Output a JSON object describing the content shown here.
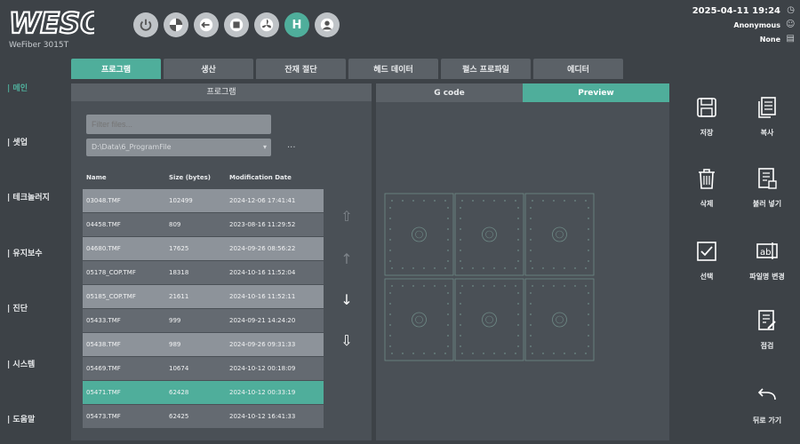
{
  "app": {
    "logo_text": "WESO",
    "model": "WeFiber 3015T"
  },
  "status": {
    "datetime": "2025-04-11 19:24",
    "user": "Anonymous",
    "file": "None"
  },
  "topbar": {
    "icons": [
      "power-icon",
      "pie-icon",
      "back-arrow-icon",
      "stop-icon",
      "fan-icon",
      "head-icon",
      "user-icon"
    ],
    "head_label": "H"
  },
  "leftnav": {
    "items": [
      {
        "label": "| 메인",
        "active": true
      },
      {
        "label": "| 셋업",
        "active": false
      },
      {
        "label": "| 테크놀러지",
        "active": false
      },
      {
        "label": "| 유지보수",
        "active": false
      },
      {
        "label": "| 진단",
        "active": false
      },
      {
        "label": "| 시스템",
        "active": false
      },
      {
        "label": "| 도움말",
        "active": false
      }
    ]
  },
  "tabs": [
    "프로그램",
    "생산",
    "잔재 절단",
    "헤드 데이터",
    "펄스 프로파일",
    "에디터"
  ],
  "program_panel": {
    "header": "프로그램",
    "filter_placeholder": "Filter files...",
    "path": "D:\\Data\\6_ProgramFile",
    "ellipsis": "...",
    "columns": [
      "Name",
      "Size (bytes)",
      "Modification Date"
    ],
    "rows": [
      {
        "name": "03048.TMF",
        "size": "102499",
        "date": "2024-12-06 17:41:41",
        "style": "light"
      },
      {
        "name": "04458.TMF",
        "size": "809",
        "date": "2023-08-16 11:29:52",
        "style": "dark"
      },
      {
        "name": "04680.TMF",
        "size": "17625",
        "date": "2024-09-26 08:56:22",
        "style": "light"
      },
      {
        "name": "05178_COP.TMF",
        "size": "18318",
        "date": "2024-10-16 11:52:04",
        "style": "dark"
      },
      {
        "name": "05185_COP.TMF",
        "size": "21611",
        "date": "2024-10-16 11:52:11",
        "style": "light"
      },
      {
        "name": "05433.TMF",
        "size": "999",
        "date": "2024-09-21 14:24:20",
        "style": "dark"
      },
      {
        "name": "05438.TMF",
        "size": "989",
        "date": "2024-09-26 09:31:33",
        "style": "light"
      },
      {
        "name": "05469.TMF",
        "size": "10674",
        "date": "2024-10-12 00:18:09",
        "style": "dark"
      },
      {
        "name": "05471.TMF",
        "size": "62428",
        "date": "2024-10-12 00:33:19",
        "style": "sel"
      },
      {
        "name": "05473.TMF",
        "size": "62425",
        "date": "2024-10-12 16:41:33",
        "style": "dark"
      }
    ],
    "scroll": {
      "top": "⇧",
      "up": "↑",
      "down": "↓",
      "bottom": "⇩"
    }
  },
  "preview_panel": {
    "tabs": [
      {
        "label": "G code",
        "active": false
      },
      {
        "label": "Preview",
        "active": true
      }
    ]
  },
  "actions": [
    {
      "label": "저장",
      "icon": "save-icon"
    },
    {
      "label": "복사",
      "icon": "copy-icon"
    },
    {
      "label": "삭제",
      "icon": "delete-icon"
    },
    {
      "label": "불러 넣기",
      "icon": "import-icon"
    },
    {
      "label": "선택",
      "icon": "select-icon"
    },
    {
      "label": "파일명 변경",
      "icon": "rename-icon"
    },
    {
      "label": "점검",
      "icon": "check-icon"
    },
    {
      "label": "뒤로 가기",
      "icon": "back-icon"
    }
  ],
  "colors": {
    "accent": "#4fae9b",
    "background": "#3d4247",
    "panel": "#4a5056"
  }
}
